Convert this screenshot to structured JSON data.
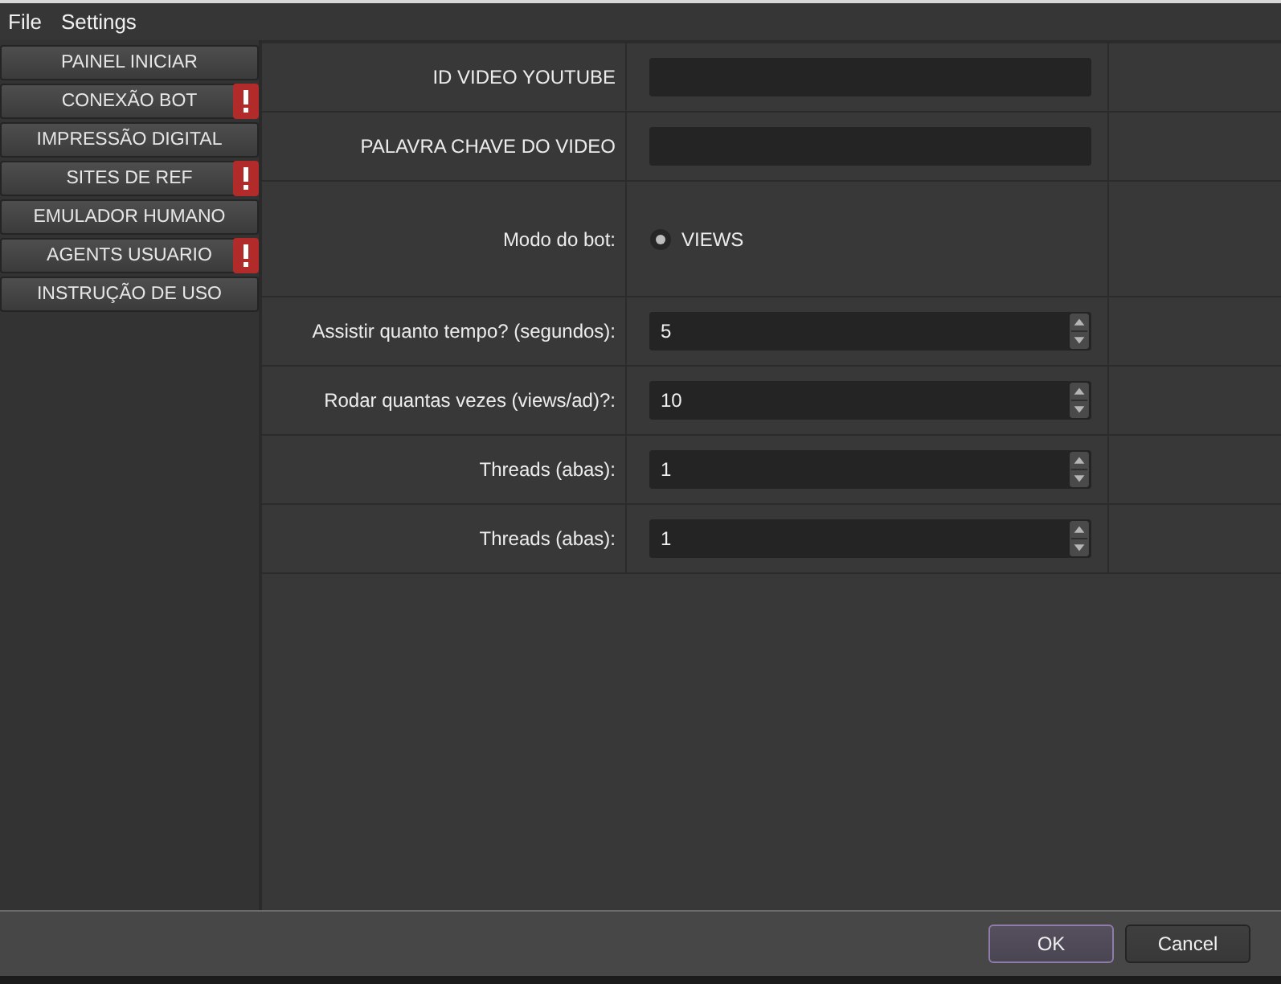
{
  "menu": [
    "File",
    "Settings"
  ],
  "sidebar": {
    "items": [
      {
        "label": "PAINEL INICIAR",
        "alert": false
      },
      {
        "label": "CONEXÃO BOT",
        "alert": true
      },
      {
        "label": "IMPRESSÃO DIGITAL",
        "alert": false
      },
      {
        "label": "SITES DE REF",
        "alert": true
      },
      {
        "label": "EMULADOR HUMANO",
        "alert": false
      },
      {
        "label": "AGENTS USUARIO",
        "alert": true
      },
      {
        "label": "INSTRUÇÃO DE USO",
        "alert": false
      }
    ]
  },
  "form": {
    "rows": [
      {
        "kind": "text",
        "label": "ID VIDEO YOUTUBE"
      },
      {
        "kind": "text",
        "label": "PALAVRA CHAVE DO VIDEO"
      },
      {
        "kind": "radio",
        "label": "Modo do bot:",
        "options": [
          {
            "label": "VIEWS",
            "selected": true
          }
        ]
      },
      {
        "kind": "spin",
        "label": "Assistir quanto tempo? (segundos):",
        "value": "5"
      },
      {
        "kind": "spin",
        "label": "Rodar quantas vezes (views/ad)?:",
        "value": "10"
      },
      {
        "kind": "spin",
        "label": "Threads (abas):",
        "value": "1"
      },
      {
        "kind": "spin",
        "label": "Threads (abas):",
        "value": "1"
      }
    ]
  },
  "buttons": [
    {
      "label": "OK",
      "default": true
    },
    {
      "label": "Cancel",
      "default": false
    }
  ]
}
